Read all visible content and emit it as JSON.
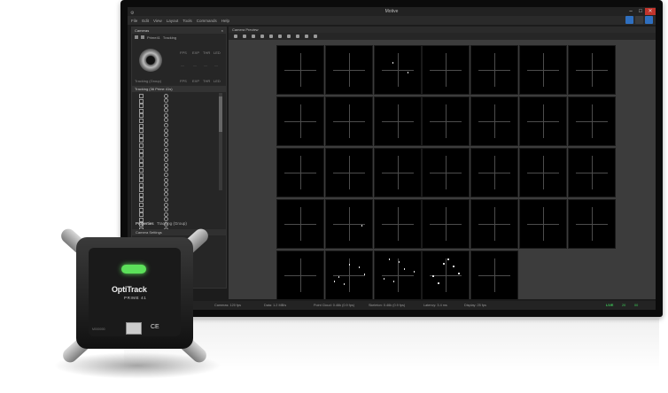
{
  "window": {
    "title": "Motive",
    "menu": [
      "File",
      "Edit",
      "View",
      "Layout",
      "Tools",
      "Commands",
      "Help"
    ],
    "controls": [
      "–",
      "□",
      "✕"
    ]
  },
  "camera_panel": {
    "header": "Cameras",
    "toolbar": [
      "Prime41",
      "Tracking"
    ],
    "camera_group_label": "Tracking (Group)",
    "columns": [
      "FPS",
      "EXP",
      "THR",
      "LED"
    ],
    "column_values": [
      "—",
      "—",
      "—",
      "—"
    ],
    "tree_header": "Tracking (36 Prime 41s)",
    "tree_columns": [
      "",
      "FPS",
      "EXP",
      "THR",
      "LED"
    ],
    "rows_count": 28
  },
  "properties": {
    "tab_active": "Properties",
    "tab_other": "Tracking (Group)",
    "section": "Camera Settings"
  },
  "viewport": {
    "header": "Camera Preview",
    "grid_cols": 7,
    "grid_rows": 5,
    "cells": 33
  },
  "status_bar": {
    "cameras": "Cameras: 120 fps",
    "data": "Data: 1.2 MB/s",
    "point_cloud": "Point Cloud: 0.46k (0.9 fps)",
    "skeleton": "Skeleton: 0.46k (0.9 fps)",
    "latency": "Latency: 3.4 ms",
    "display": "Display: 25 fps",
    "live": "LIVE",
    "live_values": [
      "20",
      "00"
    ]
  },
  "device": {
    "brand": "OptiTrack",
    "model": "PRIME 41",
    "ce": "CE",
    "serial": "M000000"
  },
  "colors": {
    "accent_green": "#3fd05a",
    "toolbar_blue": "#2f6fbf"
  }
}
